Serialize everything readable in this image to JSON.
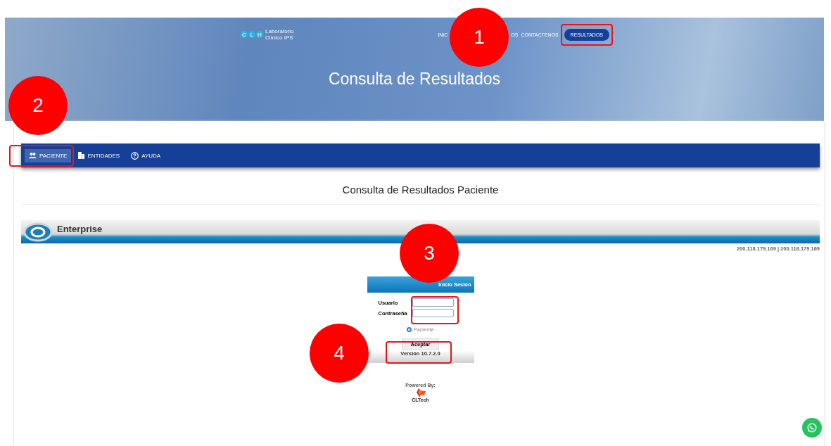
{
  "header": {
    "logo_text": [
      "Laboratorio",
      "Clínico IPS"
    ],
    "logo_letters": [
      "C",
      "L",
      "H"
    ],
    "nav": [
      {
        "label": "INIC",
        "selected": false
      },
      {
        "label": "OS",
        "selected": false
      },
      {
        "label": "CONTACTENOS",
        "selected": false
      },
      {
        "label": "RESULTADOS",
        "selected": true
      }
    ],
    "hero_title": "Consulta de Resultados"
  },
  "tabs": [
    {
      "label": "PACIENTE",
      "selected": true,
      "kind": "people"
    },
    {
      "label": "ENTIDADES",
      "selected": false,
      "kind": "building"
    },
    {
      "label": "AYUDA",
      "selected": false,
      "kind": "help"
    }
  ],
  "page_title": "Consulta de Resultados Paciente",
  "banner": {
    "brand": "Enterprise",
    "ip_text": "200.118.179.169 | 200.118.179.169"
  },
  "login": {
    "title": "Inicio Sesión",
    "fields": [
      {
        "label": "Usuario"
      },
      {
        "label": "Contraseña"
      }
    ],
    "radio": {
      "label": "Paciente",
      "checked": true
    },
    "button": "Aceptar",
    "version": "Versión 10.7.2.0"
  },
  "footer": {
    "powered_by": "Powered By:",
    "brand": "CLTech"
  },
  "annotations": [
    {
      "label": "1"
    },
    {
      "label": "2"
    },
    {
      "label": "3"
    },
    {
      "label": "4"
    }
  ]
}
